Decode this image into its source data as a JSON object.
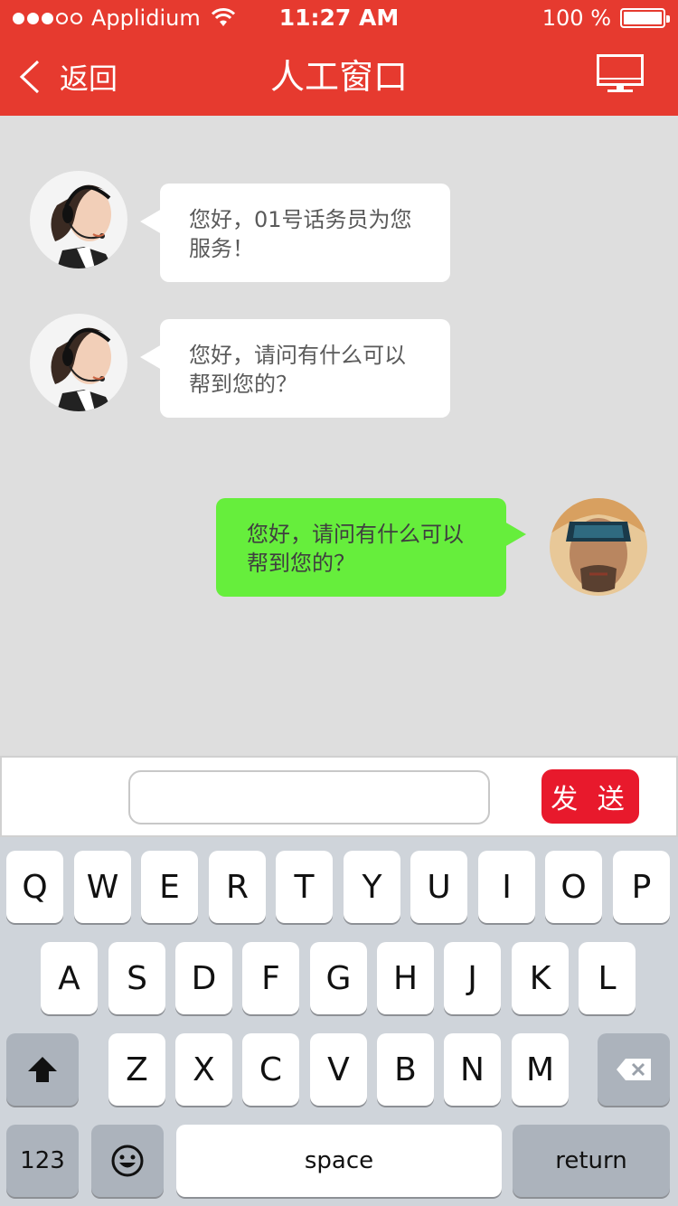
{
  "status_bar": {
    "carrier": "Applidium",
    "time": "11:27 AM",
    "battery": "100 %"
  },
  "nav": {
    "back_label": "返回",
    "title": "人工窗口"
  },
  "messages": [
    {
      "side": "left",
      "sender": "agent",
      "line1": "您好，01号话务员为您",
      "line2": "服务！"
    },
    {
      "side": "left",
      "sender": "agent",
      "line1": "您好，请问有什么可以",
      "line2": "帮到您的？"
    },
    {
      "side": "right",
      "sender": "user",
      "line1": "您好，请问有什么可以",
      "line2": "帮到您的？"
    }
  ],
  "input": {
    "value": "",
    "send_label": "发 送"
  },
  "keyboard": {
    "row1": [
      "Q",
      "W",
      "E",
      "R",
      "T",
      "Y",
      "U",
      "I",
      "O",
      "P"
    ],
    "row2": [
      "A",
      "S",
      "D",
      "F",
      "G",
      "H",
      "J",
      "K",
      "L"
    ],
    "row3": [
      "Z",
      "X",
      "C",
      "V",
      "B",
      "N",
      "M"
    ],
    "numbers_label": "123",
    "space_label": "space",
    "return_label": "return"
  },
  "colors": {
    "header": "#e63a2f",
    "user_bubble": "#66ee3c",
    "send_button": "#e8192c",
    "background": "#dedede"
  }
}
